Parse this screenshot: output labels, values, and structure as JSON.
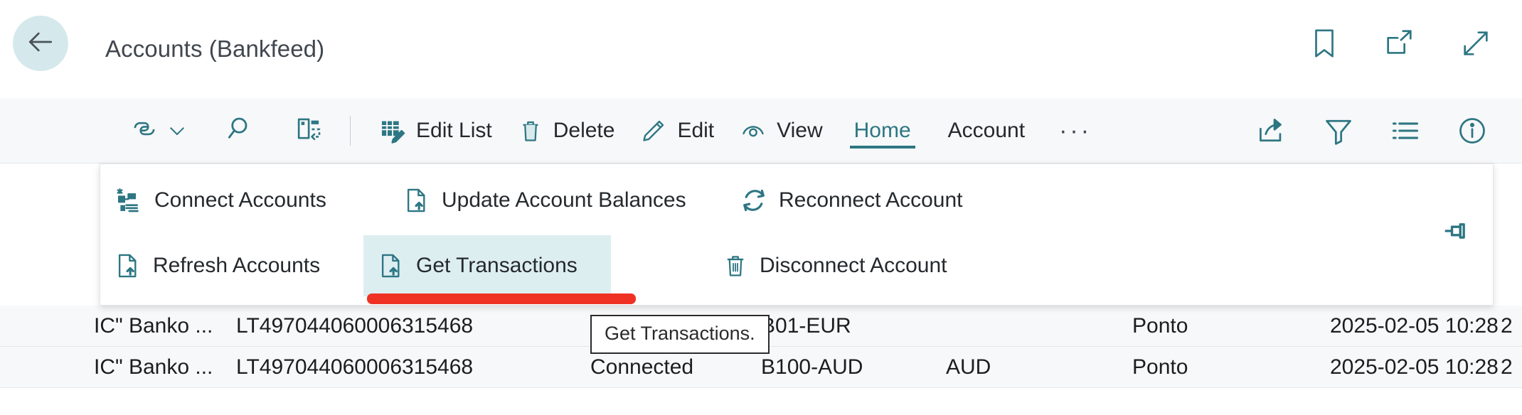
{
  "window": {
    "title": "Accounts (Bankfeed)",
    "back_icon": "back-arrow-icon",
    "actions": [
      {
        "name": "bookmark-icon",
        "label": "Bookmark"
      },
      {
        "name": "open-in-new-window-icon",
        "label": "Open in new window"
      },
      {
        "name": "expand-icon",
        "label": "Expand"
      }
    ]
  },
  "command_bar": {
    "left_icons": [
      {
        "name": "copilot-icon",
        "label": "Copilot"
      },
      {
        "name": "search-icon",
        "label": "Search"
      },
      {
        "name": "page-refresh-icon",
        "label": "Refresh page"
      }
    ],
    "items": [
      {
        "name": "edit-list-button",
        "label": "Edit List",
        "icon": "edit-list-icon"
      },
      {
        "name": "delete-button",
        "label": "Delete",
        "icon": "trash-icon"
      },
      {
        "name": "edit-button",
        "label": "Edit",
        "icon": "pencil-icon"
      },
      {
        "name": "view-button",
        "label": "View",
        "icon": "eye-icon"
      }
    ],
    "tabs": [
      {
        "name": "tab-home",
        "label": "Home",
        "active": true
      },
      {
        "name": "tab-account",
        "label": "Account",
        "active": false
      }
    ],
    "overflow_label": "···",
    "right_icons": [
      {
        "name": "share-icon",
        "label": "Share"
      },
      {
        "name": "filter-icon",
        "label": "Filter"
      },
      {
        "name": "list-view-icon",
        "label": "List view"
      },
      {
        "name": "info-icon",
        "label": "Details"
      }
    ]
  },
  "ribbon": {
    "row1": [
      {
        "name": "connect-accounts-button",
        "label": "Connect Accounts",
        "icon": "connect-accounts-icon"
      },
      {
        "name": "update-account-balances-button",
        "label": "Update Account Balances",
        "icon": "page-arrow-up-icon"
      },
      {
        "name": "reconnect-account-button",
        "label": "Reconnect Account",
        "icon": "refresh-circular-icon"
      }
    ],
    "row2": [
      {
        "name": "refresh-accounts-button",
        "label": "Refresh Accounts",
        "icon": "page-arrow-up-icon"
      },
      {
        "name": "get-transactions-button",
        "label": "Get Transactions",
        "icon": "page-arrow-up-icon",
        "highlighted": true
      },
      {
        "name": "disconnect-account-button",
        "label": "Disconnect Account",
        "icon": "trash-icon"
      }
    ],
    "pin": {
      "name": "pin-icon",
      "label": "Pin"
    },
    "annotation_color": "#ef3124"
  },
  "tooltip": {
    "text": "Get Transactions."
  },
  "grid": {
    "rows": [
      {
        "name": "IC\" Banko ...",
        "iban": "LT497044060006315468",
        "status": "",
        "account": "B01-EUR",
        "currency": "",
        "provider": "Ponto",
        "date": "2025-02-05 10:28",
        "tail": "2"
      },
      {
        "name": "IC\" Banko ...",
        "iban": "LT497044060006315468",
        "status": "Connected",
        "account": "B100-AUD",
        "currency": "AUD",
        "provider": "Ponto",
        "date": "2025-02-05 10:28",
        "tail": "2"
      }
    ]
  },
  "theme": {
    "accent": "#2d7683",
    "back_button_bg": "#d5e9ec",
    "highlight_bg": "#ddeef1",
    "annotation_red": "#ef3124",
    "row_bg": "#f7f8f9"
  }
}
